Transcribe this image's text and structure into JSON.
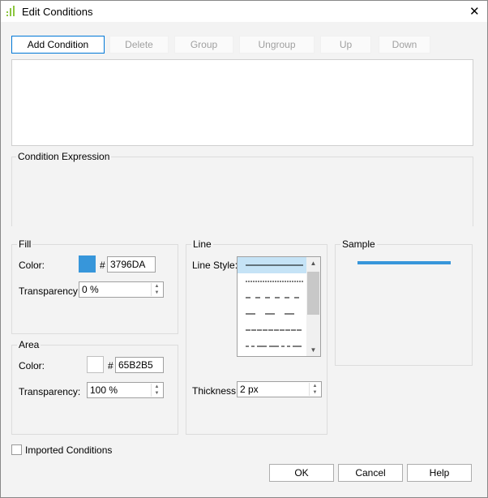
{
  "window": {
    "title": "Edit Conditions",
    "close": "✕"
  },
  "toolbar": {
    "add": "Add Condition",
    "delete": "Delete",
    "group": "Group",
    "ungroup": "Ungroup",
    "up": "Up",
    "down": "Down"
  },
  "expression": {
    "label": "Condition Expression"
  },
  "fill": {
    "label": "Fill",
    "color_label": "Color:",
    "hash": "#",
    "color": "3796DA",
    "swatch": "#3796DA",
    "transparency_label": "Transparency:",
    "transparency": "0 %"
  },
  "area": {
    "label": "Area",
    "color_label": "Color:",
    "hash": "#",
    "color": "65B2B5",
    "swatch": "#FFFFFF",
    "transparency_label": "Transparency:",
    "transparency": "100 %"
  },
  "line": {
    "label": "Line",
    "style_label": "Line Style:",
    "styles": [
      "solid",
      "dotted",
      "dashed",
      "long-dash",
      "dense-dash",
      "dash-dot"
    ],
    "selected": "solid",
    "thickness_label": "Thickness:",
    "thickness": "2 px"
  },
  "sample": {
    "label": "Sample",
    "color": "#3796DA"
  },
  "imported": {
    "label": "Imported Conditions",
    "checked": false
  },
  "footer": {
    "ok": "OK",
    "cancel": "Cancel",
    "help": "Help"
  }
}
